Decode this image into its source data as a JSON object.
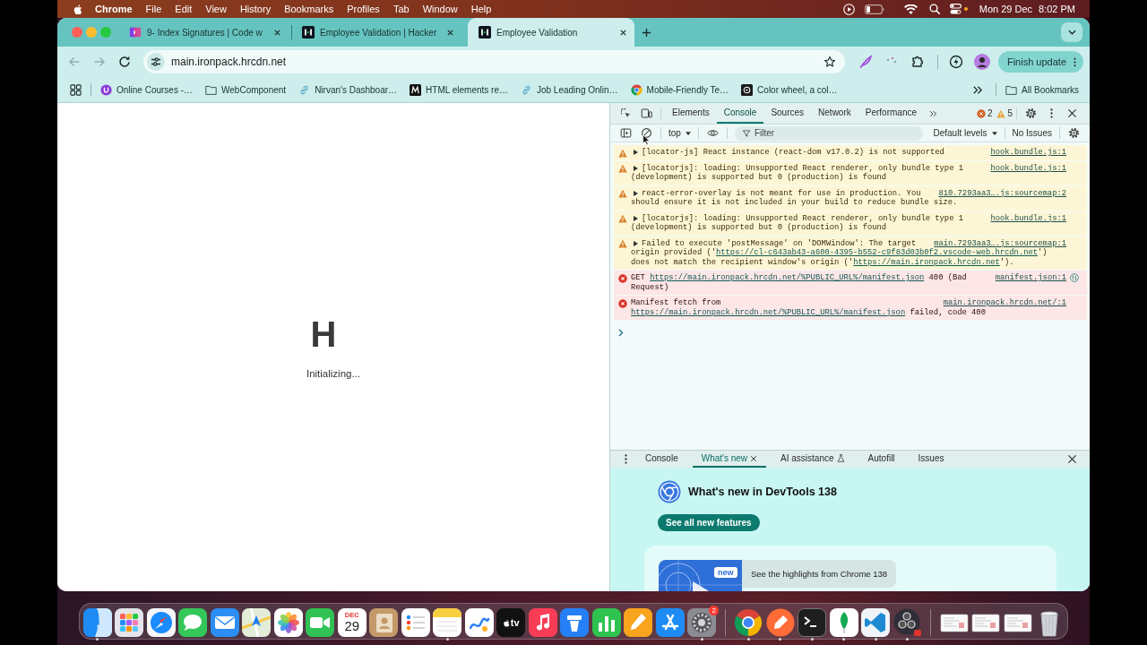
{
  "menu_bar": {
    "app": "Chrome",
    "menus": [
      "File",
      "Edit",
      "View",
      "History",
      "Bookmarks",
      "Profiles",
      "Tab",
      "Window",
      "Help"
    ],
    "date": "Mon 29 Dec",
    "time": "8:02 PM"
  },
  "browser": {
    "tabs": [
      {
        "title": "9- Index Signatures | Code w",
        "kind": "course",
        "selected": false
      },
      {
        "title": "Employee Validation | Hacker",
        "kind": "hackerrank",
        "selected": false
      },
      {
        "title": "Employee Validation",
        "kind": "hackerrank",
        "selected": true
      }
    ],
    "back_disabled": true,
    "forward_disabled": true,
    "address": "main.ironpack.hrcdn.net",
    "update_button": "Finish update",
    "bookmarks": [
      {
        "kind": "course",
        "label": "Online Courses -…"
      },
      {
        "kind": "folder",
        "label": "WebComponent"
      },
      {
        "kind": "link",
        "label": "Nirvan's Dashboar…"
      },
      {
        "kind": "zigzag",
        "label": "HTML elements re…"
      },
      {
        "kind": "link",
        "label": "Job Leading Onlin…"
      },
      {
        "kind": "chrome",
        "label": "Mobile-Friendly Te…"
      },
      {
        "kind": "wheel",
        "label": "Color wheel, a col…"
      }
    ],
    "all_bookmarks": "All Bookmarks"
  },
  "page": {
    "logo": "H",
    "status": "Initializing..."
  },
  "devtools": {
    "panel_tabs": [
      {
        "label": "Elements",
        "selected": false
      },
      {
        "label": "Console",
        "selected": true
      },
      {
        "label": "Sources",
        "selected": false
      },
      {
        "label": "Network",
        "selected": false
      },
      {
        "label": "Performance",
        "selected": false
      }
    ],
    "error_count": "2",
    "warning_count": "5",
    "console_toolbar": {
      "context": "top",
      "filter": {
        "placeholder": "Filter"
      },
      "levels": "Default levels",
      "issues": "No Issues"
    },
    "messages": [
      {
        "kind": "warning",
        "expandable": true,
        "lines": [
          {
            "parts": [
              {
                "text": "[locator-js] React instance (react-dom v17.0.2) is not supported",
                "link": false
              }
            ]
          }
        ],
        "source": "hook.bundle.js:1",
        "request_icon": false
      },
      {
        "kind": "warning",
        "expandable": true,
        "lines": [
          {
            "parts": [
              {
                "text": "[locatorjs]: loading: Unsupported React renderer, only bundle type 1",
                "link": false
              }
            ]
          },
          {
            "parts": [
              {
                "text": "(development) is supported but 0 (production) is found",
                "link": false
              }
            ]
          }
        ],
        "source": "hook.bundle.js:1",
        "request_icon": false
      },
      {
        "kind": "warning",
        "expandable": true,
        "lines": [
          {
            "parts": [
              {
                "text": "react-error-overlay is not meant for use in production. You",
                "link": false
              }
            ]
          },
          {
            "parts": [
              {
                "text": "should ensure it is not included in your build to reduce bundle size.",
                "link": false
              }
            ]
          }
        ],
        "source": "810.7293aa3….js:sourcemap:2",
        "request_icon": false
      },
      {
        "kind": "warning",
        "expandable": true,
        "lines": [
          {
            "parts": [
              {
                "text": "[locatorjs]: loading: Unsupported React renderer, only bundle type 1",
                "link": false
              }
            ]
          },
          {
            "parts": [
              {
                "text": "(development) is supported but 0 (production) is found",
                "link": false
              }
            ]
          }
        ],
        "source": "hook.bundle.js:1",
        "request_icon": false
      },
      {
        "kind": "warning",
        "expandable": true,
        "lines": [
          {
            "parts": [
              {
                "text": "Failed to execute 'postMessage' on 'DOMWindow': The target",
                "link": false
              }
            ]
          },
          {
            "parts": [
              {
                "text": "origin provided ('",
                "link": false
              },
              {
                "text": "https://cl-c643ab43-a600-4395-b552-c9f83d03b0f2.vscode-web.hrcdn.net",
                "link": true
              },
              {
                "text": "')",
                "link": false
              }
            ]
          },
          {
            "parts": [
              {
                "text": "does not match the recipient window's origin ('",
                "link": false
              },
              {
                "text": "https://main.ironpack.hrcdn.net",
                "link": true
              },
              {
                "text": "').",
                "link": false
              }
            ]
          }
        ],
        "source": "main.7293aa3….js:sourcemap:1",
        "request_icon": false
      },
      {
        "kind": "error",
        "expandable": false,
        "lines": [
          {
            "parts": [
              {
                "text": "GET ",
                "link": false
              },
              {
                "text": "https://main.ironpack.hrcdn.net/%PUBLIC_URL%/manifest.json",
                "link": true
              },
              {
                "text": " 400 (Bad",
                "link": false
              }
            ]
          },
          {
            "parts": [
              {
                "text": "Request)",
                "link": false
              }
            ]
          }
        ],
        "source": "manifest.json:1",
        "request_icon": true
      },
      {
        "kind": "error",
        "expandable": false,
        "lines": [
          {
            "parts": [
              {
                "text": "Manifest fetch from",
                "link": false
              }
            ]
          },
          {
            "parts": [
              {
                "text": "https://main.ironpack.hrcdn.net/%PUBLIC_URL%/manifest.json",
                "link": true
              },
              {
                "text": " failed, code 400",
                "link": false
              }
            ]
          }
        ],
        "source": "main.ironpack.hrcdn.net/:1",
        "request_icon": false
      }
    ],
    "drawer": {
      "tabs": [
        {
          "label": "Console",
          "selected": false,
          "closable": false,
          "experimental": false
        },
        {
          "label": "What's new",
          "selected": true,
          "closable": true,
          "experimental": false
        },
        {
          "label": "AI assistance",
          "selected": false,
          "closable": false,
          "experimental": true
        },
        {
          "label": "Autofill",
          "selected": false,
          "closable": false,
          "experimental": false
        },
        {
          "label": "Issues",
          "selected": false,
          "closable": false,
          "experimental": false
        }
      ],
      "heading": "What's new in DevTools 138",
      "button": "See all new features",
      "card": {
        "badge": "new",
        "text": "See the highlights from Chrome 138"
      }
    }
  },
  "dock": {
    "groups": [
      {
        "apps": [
          {
            "kind": "finder",
            "running": true
          },
          {
            "kind": "launchpad",
            "running": false
          },
          {
            "kind": "safari",
            "running": false
          },
          {
            "kind": "messages",
            "running": false
          },
          {
            "kind": "mail",
            "running": false
          },
          {
            "kind": "maps",
            "running": false
          },
          {
            "kind": "photos",
            "running": false
          },
          {
            "kind": "facetime",
            "running": false
          },
          {
            "kind": "calendar",
            "running": false,
            "month": "DEC",
            "day": "29"
          },
          {
            "kind": "contacts",
            "running": false
          },
          {
            "kind": "reminders",
            "running": false
          },
          {
            "kind": "notes",
            "running": true
          },
          {
            "kind": "freeform",
            "running": false
          },
          {
            "kind": "tv",
            "running": false,
            "label": "tv"
          },
          {
            "kind": "music",
            "running": false
          },
          {
            "kind": "keynote",
            "running": false
          },
          {
            "kind": "numbers",
            "running": false
          },
          {
            "kind": "pages",
            "running": false
          },
          {
            "kind": "appstore",
            "running": false
          },
          {
            "kind": "settings",
            "running": true,
            "badge": "2"
          }
        ]
      },
      {
        "apps": [
          {
            "kind": "chrome",
            "running": true
          },
          {
            "kind": "postman",
            "running": true
          },
          {
            "kind": "terminal",
            "running": true
          },
          {
            "kind": "mongodb",
            "running": true
          },
          {
            "kind": "vscode",
            "running": true
          },
          {
            "kind": "obs",
            "running": true
          }
        ]
      },
      {
        "apps": [
          {
            "kind": "thumbnail",
            "running": false
          },
          {
            "kind": "thumbnail",
            "running": false
          },
          {
            "kind": "thumbnail",
            "running": false
          },
          {
            "kind": "trash",
            "running": false
          }
        ]
      }
    ]
  }
}
